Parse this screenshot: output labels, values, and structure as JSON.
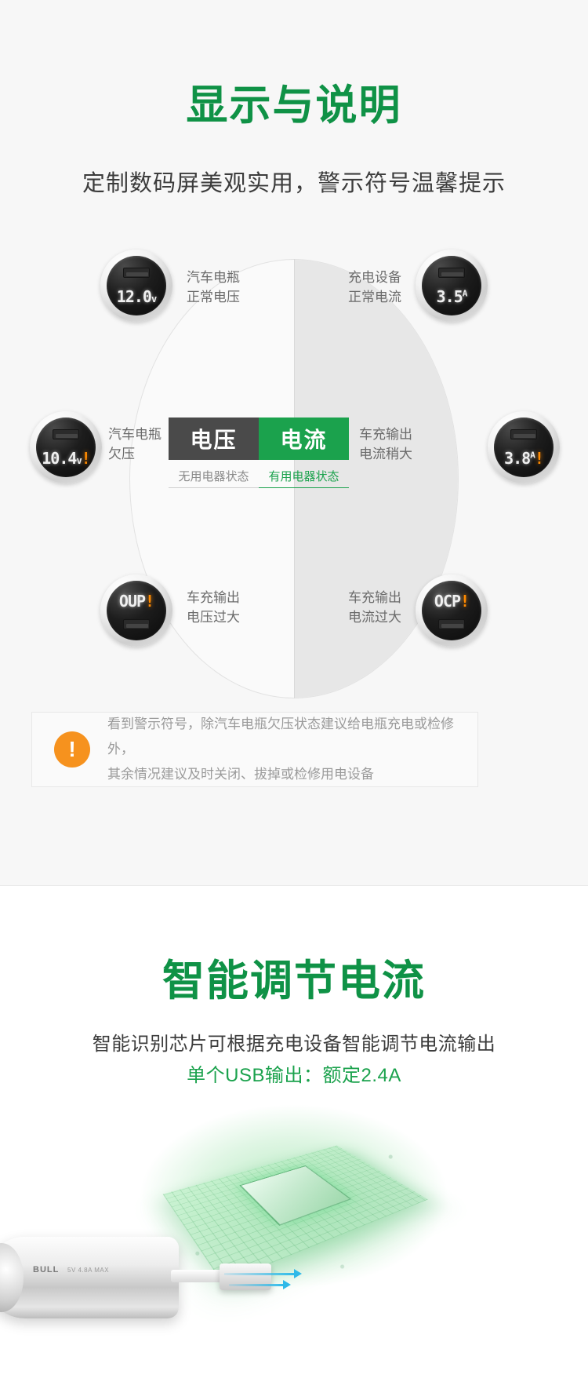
{
  "section1": {
    "title": "显示与说明",
    "subtitle": "定制数码屏美观实用，警示符号温馨提示",
    "accent_green": "#0f9246",
    "tab_green": "#1ba24d",
    "tab_dark": "#4a4a4a",
    "tabs": {
      "voltage_label": "电压",
      "current_label": "电流",
      "voltage_sub": "无用电器状态",
      "current_sub": "有用电器状态"
    },
    "nodes": [
      {
        "id": "top-left",
        "led_value": "12.0",
        "led_unit": "v",
        "led_sup": "",
        "warning": false,
        "label_line1": "汽车电瓶",
        "label_line2": "正常电压"
      },
      {
        "id": "top-right",
        "led_value": "3.5",
        "led_unit": "",
        "led_sup": "A",
        "warning": false,
        "label_line1": "充电设备",
        "label_line2": "正常电流"
      },
      {
        "id": "mid-left",
        "led_value": "10.4",
        "led_unit": "v",
        "led_sup": "",
        "warning": true,
        "label_line1": "汽车电瓶",
        "label_line2": "欠压"
      },
      {
        "id": "mid-right",
        "led_value": "3.8",
        "led_unit": "",
        "led_sup": "A",
        "warning": true,
        "label_line1": "车充输出",
        "label_line2": "电流稍大"
      },
      {
        "id": "bottom-left",
        "led_value": "OUP",
        "led_unit": "",
        "led_sup": "",
        "warning": true,
        "label_line1": "车充输出",
        "label_line2": "电压过大"
      },
      {
        "id": "bottom-right",
        "led_value": "OCP",
        "led_unit": "",
        "led_sup": "",
        "warning": true,
        "label_line1": "车充输出",
        "label_line2": "电流过大"
      }
    ],
    "notice": {
      "icon": "exclamation-icon",
      "icon_glyph": "!",
      "icon_color": "#f6921e",
      "line1": "看到警示符号，除汽车电瓶欠压状态建议给电瓶充电或检修外，",
      "line2": "其余情况建议及时关闭、拔掉或检修用电设备"
    }
  },
  "section2": {
    "title": "智能调节电流",
    "desc_line1": "智能识别芯片可根据充电设备智能调节电流输出",
    "desc_line2": "单个USB输出：额定2.4A",
    "product": {
      "brand": "BULL",
      "model": "5V  4.8A MAX"
    }
  }
}
